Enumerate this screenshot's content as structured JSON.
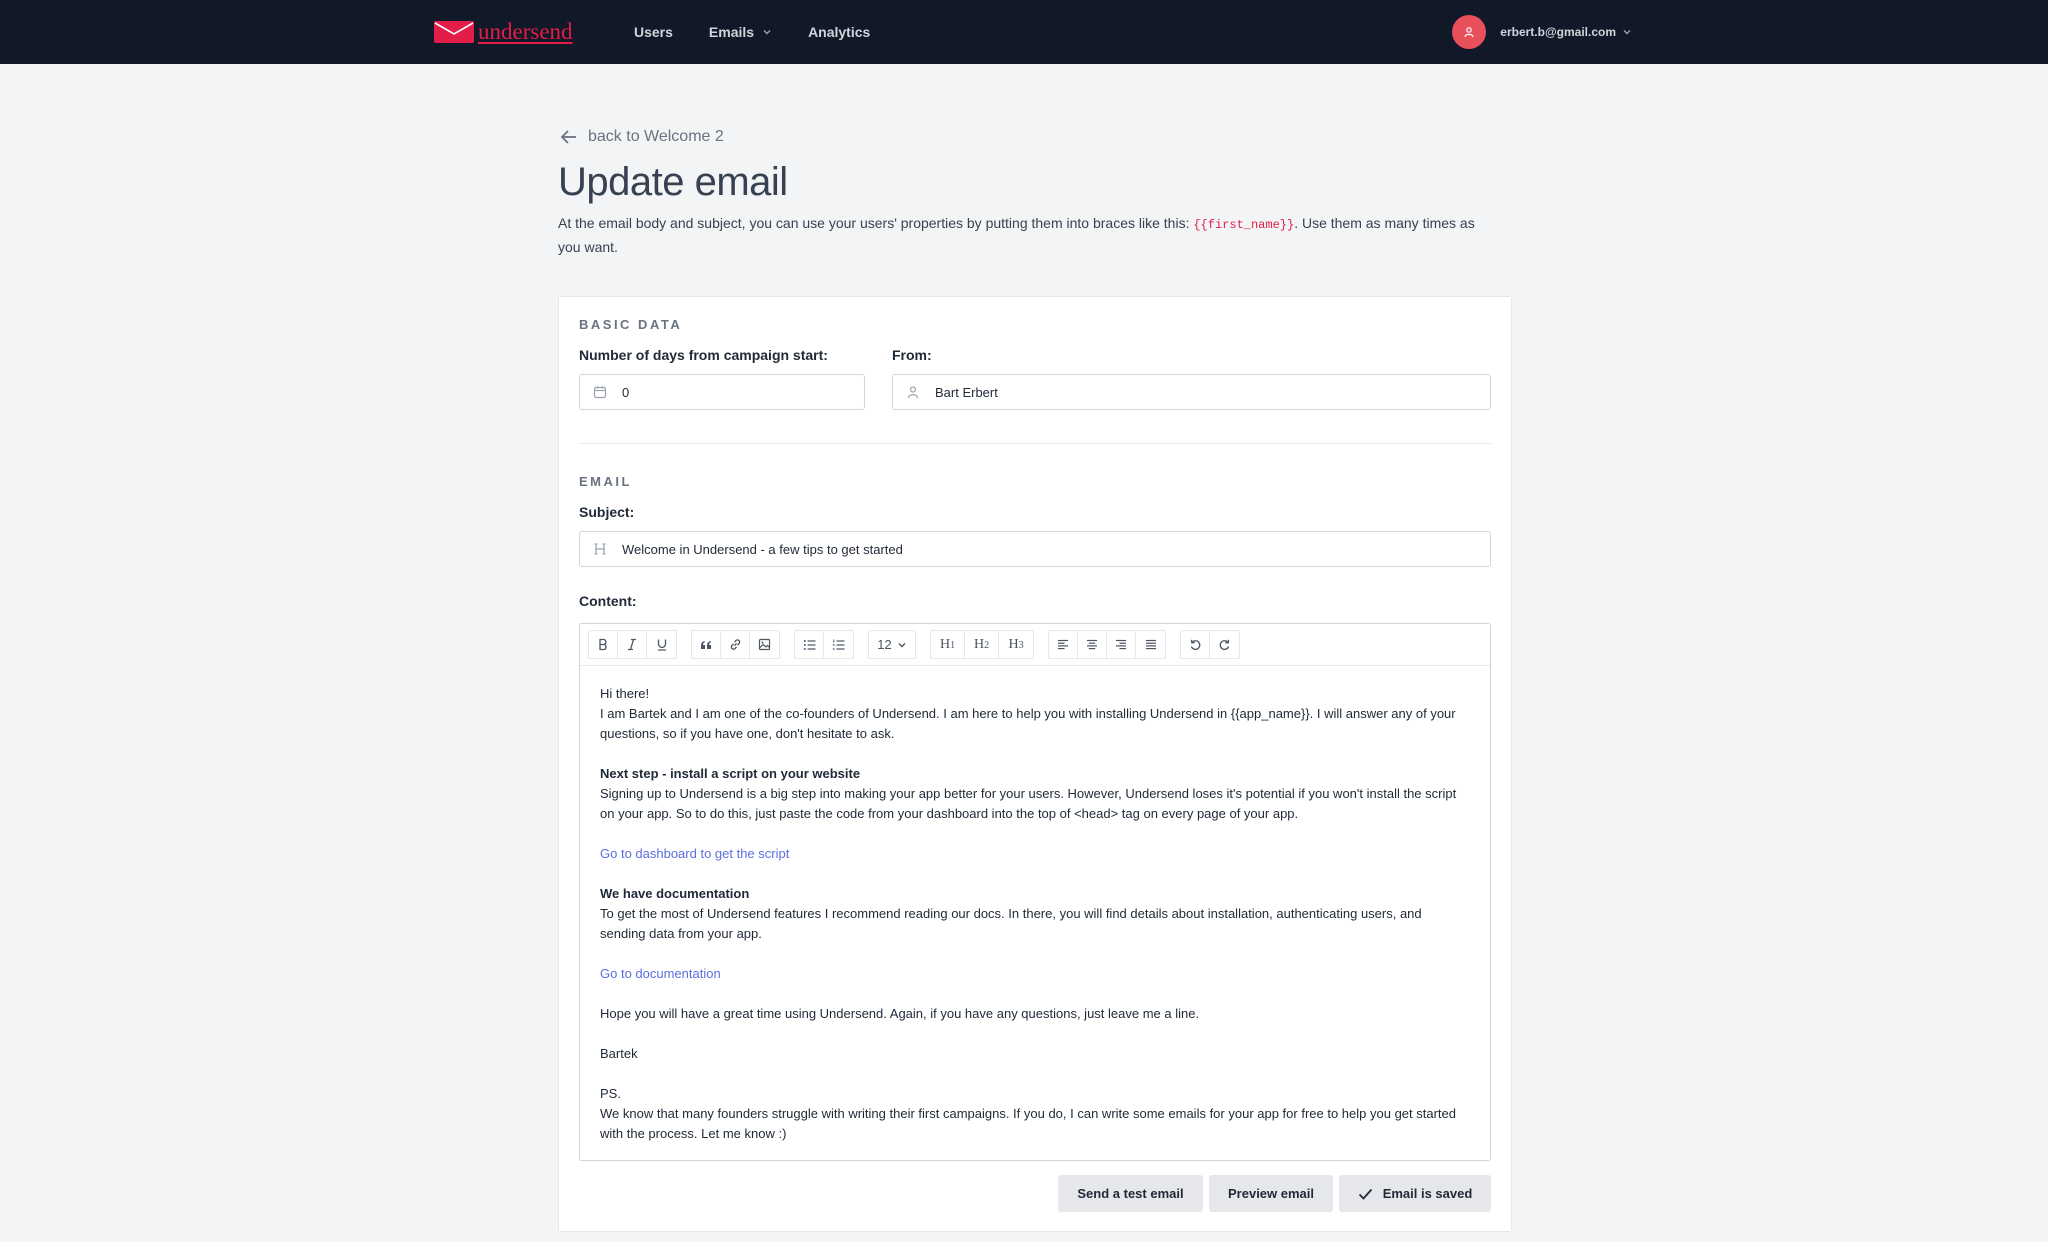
{
  "nav": {
    "logo_text": "undersend",
    "links": [
      {
        "label": "Users"
      },
      {
        "label": "Emails"
      },
      {
        "label": "Analytics"
      }
    ],
    "user_email": "erbert.b@gmail.com"
  },
  "header": {
    "back_label": "back to Welcome 2",
    "title": "Update email",
    "intro_before": "At the email body and subject, you can use your users' properties by putting them into braces like this: ",
    "intro_code": "{{first_name}}",
    "intro_after": ". Use them as many times as you want."
  },
  "basic": {
    "section": "BASIC DATA",
    "days_label": "Number of days from campaign start:",
    "days_value": "0",
    "from_label": "From:",
    "from_value": "Bart Erbert"
  },
  "email": {
    "section": "EMAIL",
    "subject_label": "Subject:",
    "subject_value": "Welcome in Undersend - a few tips to get started",
    "content_label": "Content:",
    "font_size": "12"
  },
  "body": {
    "greeting": "Hi there!",
    "intro": "I am Bartek and I am one of the co-founders of Undersend. I am here to help you with installing Undersend in {{app_name}}. I will answer any of your questions, so if you have one, don't hesitate to ask.",
    "step_heading": "Next step - install a script on your website",
    "step_text": "Signing up to Undersend is a big step into making your app better for your users. However, Undersend loses it's potential if you won't install the script on your app. So to do this, just paste the code from your dashboard into the top of <head> tag on every page of your app.",
    "dashboard_link": "Go to dashboard to get the script",
    "docs_heading": "We have documentation",
    "docs_text": "To get the most of Undersend features I recommend reading our docs. In there, you will find details about installation, authenticating users, and sending data from your app.",
    "docs_link": "Go to documentation",
    "closing": "Hope you will have a great time using Undersend. Again, if you have any questions, just leave me a line.",
    "signature": "Bartek",
    "ps_label": "PS.",
    "ps_text": "We know that many founders struggle with writing their first campaigns. If you do, I can write some emails for your app for free to help you get started with the process. Let me know :)"
  },
  "actions": {
    "test_label": "Send a test email",
    "preview_label": "Preview email",
    "saved_label": "Email is saved"
  },
  "colors": {
    "nav_bg": "#111827",
    "brand": "#e11d48",
    "link": "#5b6fe0"
  }
}
